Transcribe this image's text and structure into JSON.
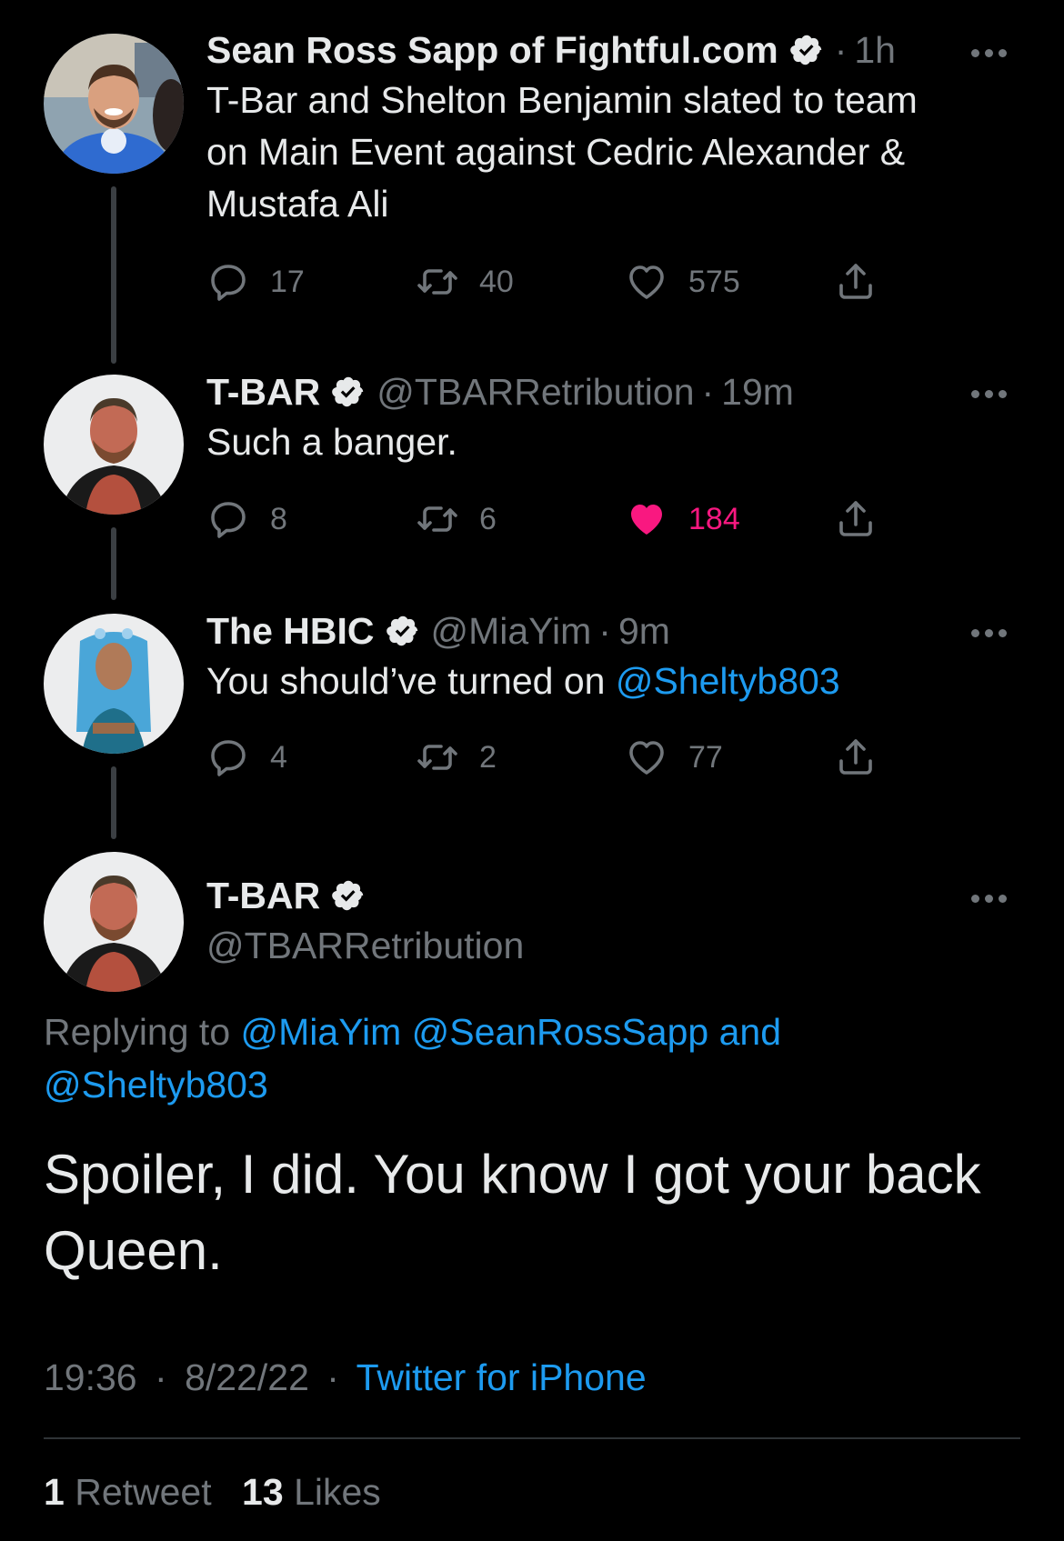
{
  "tweets": [
    {
      "name": "Sean Ross Sapp of Fightful.com",
      "handle": "",
      "time": "1h",
      "text": "T-Bar and Shelton Benjamin slated to team on Main Event against Cedric Alexander & Mustafa Ali",
      "replies": "17",
      "retweets": "40",
      "likes": "575"
    },
    {
      "name": "T-BAR",
      "handle": "@TBARRetribution",
      "time": "19m",
      "text": "Such a banger.",
      "replies": "8",
      "retweets": "6",
      "likes": "184"
    },
    {
      "name": "The HBIC",
      "handle": "@MiaYim",
      "time": "9m",
      "text_before": "You should’ve turned on ",
      "text_link": "@Sheltyb803",
      "replies": "4",
      "retweets": "2",
      "likes": "77"
    }
  ],
  "main_tweet": {
    "name": "T-BAR",
    "handle": "@TBARRetribution",
    "replying_prefix": "Replying to ",
    "replying_links": "@MiaYim @SeanRossSapp and",
    "replying_links_2": "@Sheltyb803",
    "text": "Spoiler, I did. You know I got your back Queen.",
    "time": "19:36",
    "date": "8/22/22",
    "source": "Twitter for iPhone",
    "retweet_count": "1",
    "retweet_label": "Retweet",
    "like_count": "13",
    "like_label": "Likes"
  },
  "separator": "·",
  "colors": {
    "background": "#000000",
    "link": "#1d9bf0",
    "muted": "#71767b",
    "like": "#f91880"
  },
  "icons": [
    "reply-icon",
    "retweet-icon",
    "like-icon",
    "share-icon",
    "verified-badge-icon",
    "more-icon"
  ]
}
